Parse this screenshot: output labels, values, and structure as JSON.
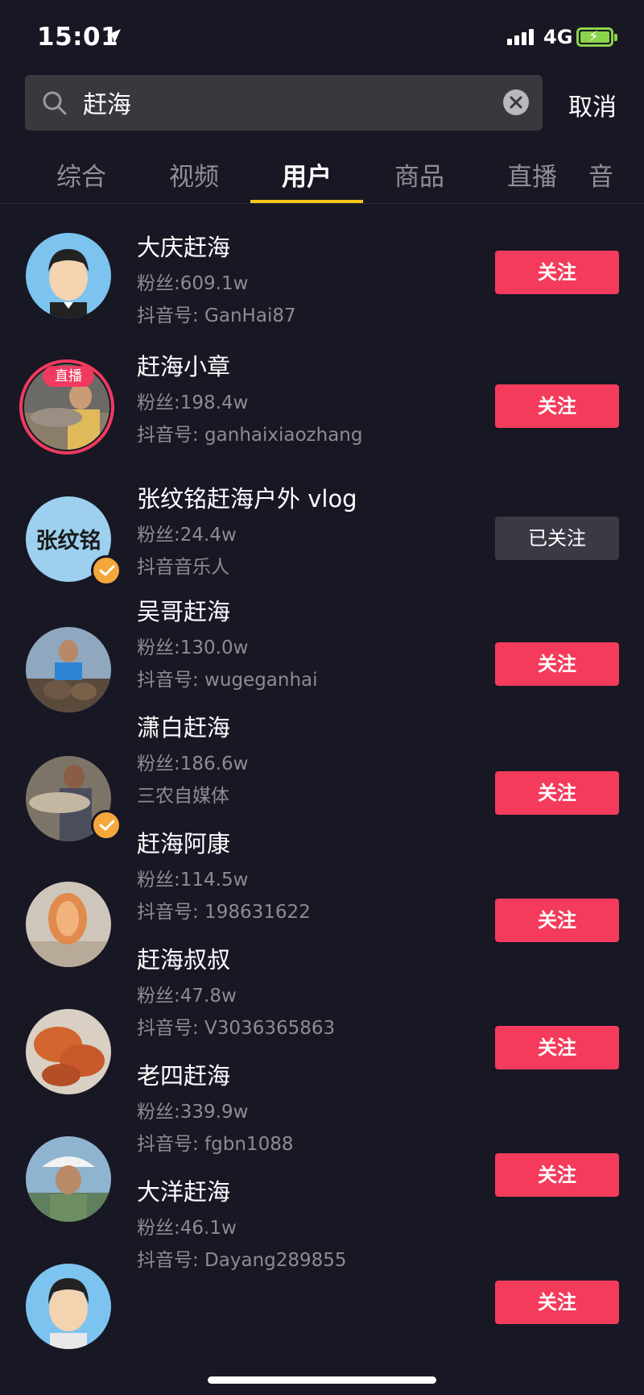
{
  "status_bar": {
    "time": "15:01",
    "network": "4G"
  },
  "search": {
    "query": "赶海",
    "cancel_label": "取消"
  },
  "tabs": [
    {
      "label": "综合"
    },
    {
      "label": "视频"
    },
    {
      "label": "用户"
    },
    {
      "label": "商品"
    },
    {
      "label": "直播"
    },
    {
      "label": "音"
    }
  ],
  "active_tab": "用户",
  "colors": {
    "accent_yellow": "#f5c518",
    "follow_red": "#f43b5b",
    "background": "#181724"
  },
  "users": [
    {
      "name": "大庆赶海",
      "fans": "粉丝:609.1w",
      "sub": "抖音号: GanHai87",
      "button": "关注",
      "followed": false,
      "live": false,
      "verified": false
    },
    {
      "name": "赶海小章",
      "fans": "粉丝:198.4w",
      "sub": "抖音号: ganhaixiaozhang",
      "button": "关注",
      "followed": false,
      "live": true,
      "live_label": "直播",
      "verified": false
    },
    {
      "name": "张纹铭赶海户外 vlog",
      "fans": "粉丝:24.4w",
      "sub": "抖音音乐人",
      "button": "已关注",
      "followed": true,
      "live": false,
      "verified": true,
      "avatar_text": "张纹铭"
    },
    {
      "name": "吴哥赶海",
      "fans": "粉丝:130.0w",
      "sub": "抖音号: wugeganhai",
      "button": "关注",
      "followed": false,
      "live": false,
      "verified": false
    },
    {
      "name": "潇白赶海",
      "fans": "粉丝:186.6w",
      "sub": "三农自媒体",
      "button": "关注",
      "followed": false,
      "live": false,
      "verified": true
    },
    {
      "name": "赶海阿康",
      "fans": "粉丝:114.5w",
      "sub": "抖音号: 198631622",
      "button": "关注",
      "followed": false,
      "live": false,
      "verified": false
    },
    {
      "name": "赶海叔叔",
      "fans": "粉丝:47.8w",
      "sub": "抖音号: V3036365863",
      "button": "关注",
      "followed": false,
      "live": false,
      "verified": false
    },
    {
      "name": "老四赶海",
      "fans": "粉丝:339.9w",
      "sub": "抖音号: fgbn1088",
      "button": "关注",
      "followed": false,
      "live": false,
      "verified": false
    },
    {
      "name": "大洋赶海",
      "fans": "粉丝:46.1w",
      "sub": "抖音号: Dayang289855",
      "button": "关注",
      "followed": false,
      "live": false,
      "verified": false
    }
  ]
}
